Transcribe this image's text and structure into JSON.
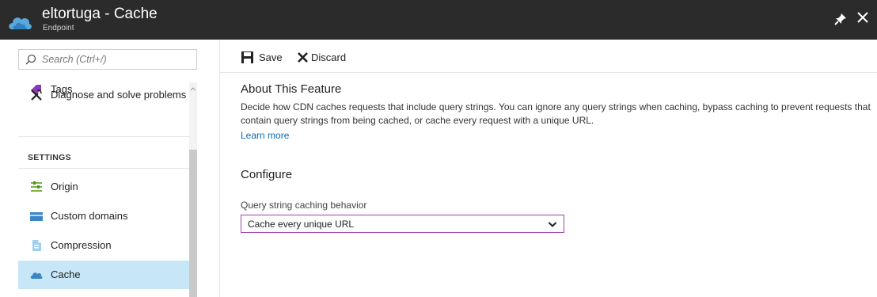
{
  "window": {
    "title": "eltortuga - Cache",
    "subtitle": "Endpoint",
    "logo_icon": "cdn-cloud-icon",
    "pin_icon": "pin-icon",
    "close_icon": "close-icon"
  },
  "sidebar": {
    "search_placeholder": "Search (Ctrl+/)",
    "items": [
      {
        "label": "Tags",
        "icon": "tag-icon"
      },
      {
        "label": "Diagnose and solve problems",
        "icon": "wrench-icon"
      }
    ],
    "section_title": "SETTINGS",
    "settings_items": [
      {
        "label": "Origin",
        "icon": "origin-icon"
      },
      {
        "label": "Custom domains",
        "icon": "domain-card-icon"
      },
      {
        "label": "Compression",
        "icon": "file-icon"
      },
      {
        "label": "Cache",
        "icon": "cloud-icon",
        "selected": true
      }
    ]
  },
  "toolbar": {
    "save_label": "Save",
    "discard_label": "Discard"
  },
  "content": {
    "about_heading": "About This Feature",
    "about_text": "Decide how CDN caches requests that include query strings. You can ignore any query strings when caching, bypass caching to prevent requests that contain query strings from being cached, or cache every request with a unique URL.",
    "learn_more": "Learn more",
    "configure_heading": "Configure",
    "field_label": "Query string caching behavior",
    "field_value": "Cache every unique URL"
  },
  "colors": {
    "titlebar": "#2b2b2b",
    "selected_bg": "#c7e6f6",
    "link": "#0b6ab7",
    "select_border": "#a23fb0"
  }
}
